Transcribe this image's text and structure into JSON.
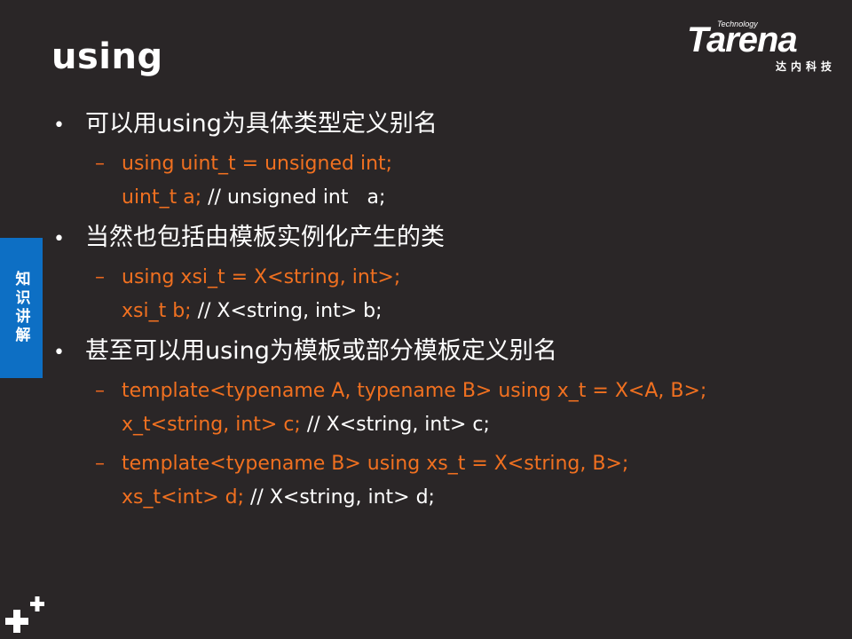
{
  "slide": {
    "title": "using",
    "side_tab": "知识讲解"
  },
  "logo": {
    "small": "Technology",
    "main": "Tarena",
    "cn": "达内科技"
  },
  "bullets": [
    {
      "text": "可以用using为具体类型定义别名",
      "subs": [
        {
          "line1": "using uint_t = unsigned int;",
          "line2_code": "uint_t a;",
          "line2_comment": " // unsigned int   a;"
        }
      ]
    },
    {
      "text": "当然也包括由模板实例化产生的类",
      "subs": [
        {
          "line1": "using xsi_t = X<string, int>;",
          "line2_code": "xsi_t b;",
          "line2_comment": " // X<string, int> b;"
        }
      ]
    },
    {
      "text": "甚至可以用using为模板或部分模板定义别名",
      "subs": [
        {
          "line1": "template<typename A, typename B> using x_t = X<A, B>;",
          "line2_code": "x_t<string, int> c;",
          "line2_comment": " // X<string, int> c;"
        },
        {
          "line1": "template<typename B> using xs_t = X<string, B>;",
          "line2_code": "xs_t<int> d;",
          "line2_comment": " // X<string, int> d;"
        }
      ]
    }
  ],
  "icons": {
    "bullet": "bullet-dot-icon",
    "dash": "dash-icon",
    "corner": "plus-mark-icon"
  },
  "colors": {
    "background": "#2a2627",
    "code": "#f07020",
    "text": "#ffffff",
    "side_tab": "#0d6fc4"
  }
}
